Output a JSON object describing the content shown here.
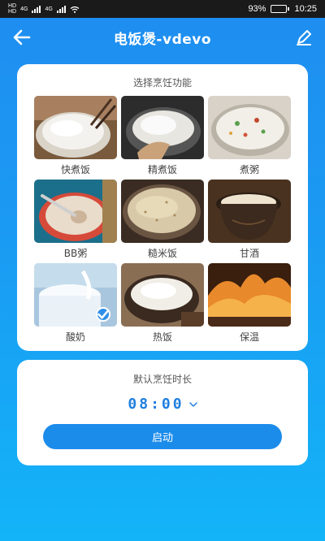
{
  "status_bar": {
    "left_tag_top": "HD",
    "left_tag_bottom": "HD",
    "net_1": "4G",
    "net_2": "4G",
    "battery_percent": "93%",
    "battery_level": 0.93,
    "time": "10:25"
  },
  "header": {
    "title": "电饭煲-vdevo",
    "back_icon": "arrow-left-icon",
    "edit_icon": "pencil-icon"
  },
  "modes": {
    "title": "选择烹饪功能",
    "items": [
      {
        "label": "快煮饭"
      },
      {
        "label": "精煮饭"
      },
      {
        "label": "煮粥"
      },
      {
        "label": "BB粥"
      },
      {
        "label": "糙米饭"
      },
      {
        "label": "甘酒"
      },
      {
        "label": "酸奶",
        "selected": true
      },
      {
        "label": "热饭"
      },
      {
        "label": "保温"
      }
    ]
  },
  "timer": {
    "title": "默认烹饪时长",
    "value": "08:00",
    "dropdown_icon": "chevron-down-icon"
  },
  "start_button": {
    "label": "启动"
  },
  "colors": {
    "accent": "#1c8ceb",
    "time_text": "#1f7fe0"
  }
}
